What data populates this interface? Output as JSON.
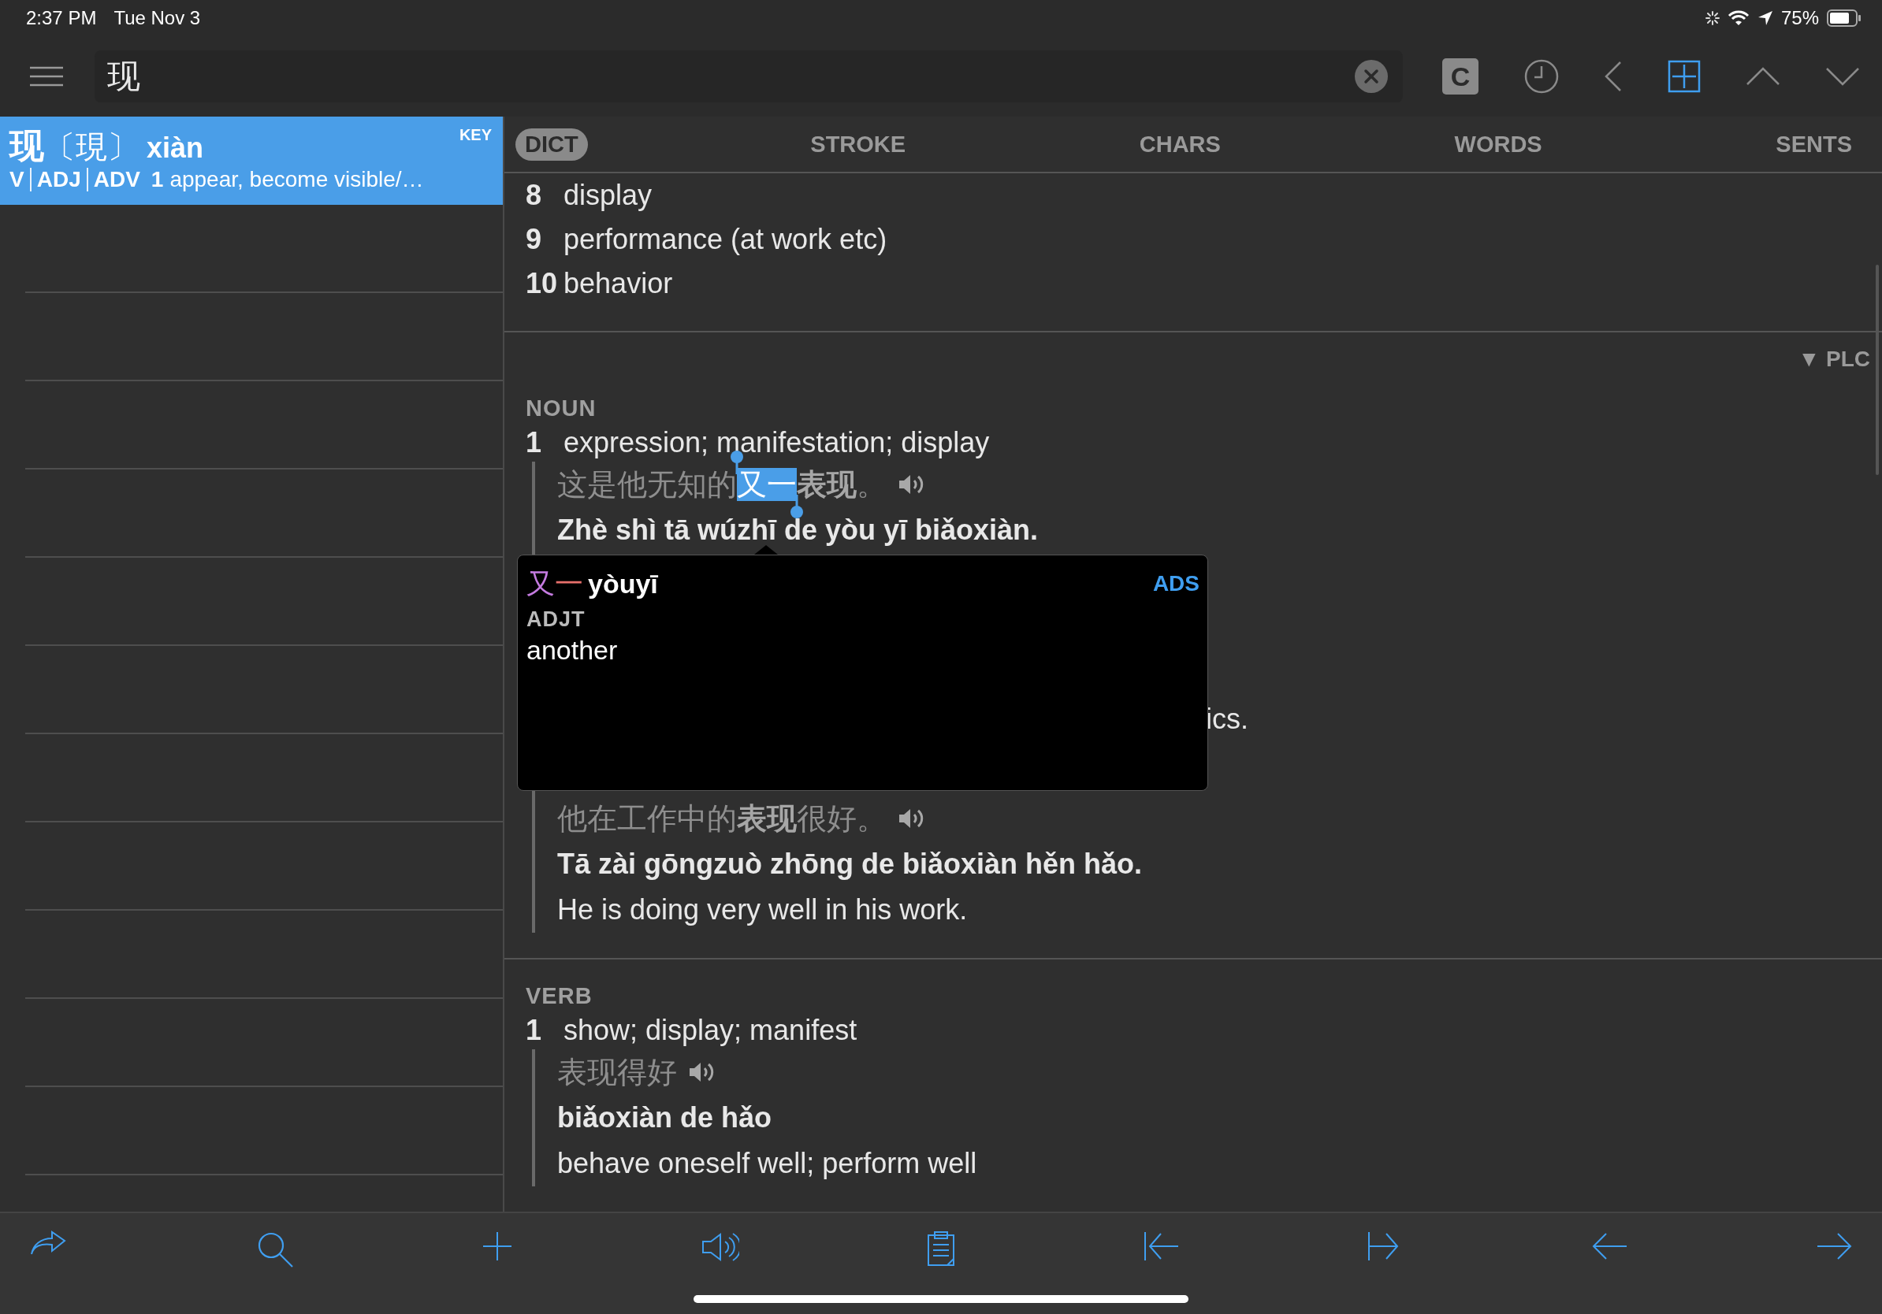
{
  "status_bar": {
    "time": "2:37 PM",
    "date": "Tue Nov 3",
    "battery": "75%"
  },
  "search": {
    "value": "现"
  },
  "header_buttons": [
    {
      "kind": "letter",
      "label": "C",
      "active": false
    },
    {
      "kind": "clock",
      "active": false
    },
    {
      "kind": "back",
      "active": false
    },
    {
      "kind": "plus",
      "active": true
    },
    {
      "kind": "up",
      "active": false
    },
    {
      "kind": "down",
      "active": false
    }
  ],
  "results": {
    "items": [
      {
        "headword": "现",
        "traditional": "〔現〕",
        "pinyin": "xiàn",
        "badge": "KEY",
        "pos": [
          "V",
          "ADJ",
          "ADV"
        ],
        "sense_number": "1",
        "gloss": "appear, become visible/…",
        "selected": true
      }
    ]
  },
  "tabs": [
    {
      "label": "DICT",
      "selected": true
    },
    {
      "label": "STROKE",
      "selected": false
    },
    {
      "label": "CHARS",
      "selected": false
    },
    {
      "label": "WORDS",
      "selected": false
    },
    {
      "label": "SENTS",
      "selected": false
    }
  ],
  "entry": {
    "lines": [
      {
        "kind": "sense",
        "number": "8",
        "text": "display"
      },
      {
        "kind": "sense",
        "number": "9",
        "text": "performance (at work etc)"
      },
      {
        "kind": "sense",
        "number": "10",
        "text": "behavior"
      },
      {
        "kind": "divider"
      },
      {
        "kind": "source",
        "text": "▼ PLC"
      },
      {
        "kind": "pos",
        "text": "NOUN"
      },
      {
        "kind": "sense",
        "number": "1",
        "text": "expression; manifestation; display"
      },
      {
        "kind": "hanzi",
        "parts": [
          {
            "text": "这是他无知的",
            "bold": false,
            "selected": false
          },
          {
            "text": "又一",
            "bold": false,
            "selected": true
          },
          {
            "text": "表现",
            "bold": true,
            "selected": false
          },
          {
            "text": "。",
            "bold": false,
            "selected": false
          }
        ]
      },
      {
        "kind": "pinyin",
        "text": "Zhè shì tā wúzhī de yòu yī biǎoxiàn."
      },
      {
        "kind": "fragment",
        "text": "ics."
      },
      {
        "kind": "hanzi",
        "parts": [
          {
            "text": "他在工作中的",
            "bold": false,
            "selected": false
          },
          {
            "text": "表现",
            "bold": true,
            "selected": false
          },
          {
            "text": "很好。",
            "bold": false,
            "selected": false
          }
        ]
      },
      {
        "kind": "pinyin",
        "text": "Tā zài gōngzuò zhōng de biǎoxiàn hěn hǎo."
      },
      {
        "kind": "translation",
        "text": "He is doing very well in his work."
      },
      {
        "kind": "divider"
      },
      {
        "kind": "pos",
        "text": "VERB"
      },
      {
        "kind": "sense",
        "number": "1",
        "text": "show; display; manifest"
      },
      {
        "kind": "hanzi",
        "parts": [
          {
            "text": "表现得好",
            "bold": false,
            "selected": false
          }
        ]
      },
      {
        "kind": "pinyin",
        "text": "biǎoxiàn de hǎo"
      },
      {
        "kind": "translation",
        "text": "behave oneself well; perform well"
      }
    ]
  },
  "popup": {
    "word_parts": [
      {
        "text": "又",
        "color": "#c47be0"
      },
      {
        "text": "一",
        "color": "#e8706c"
      }
    ],
    "pinyin": "yòuyī",
    "source": "ADS",
    "pos": "ADJT",
    "definition": "another"
  }
}
